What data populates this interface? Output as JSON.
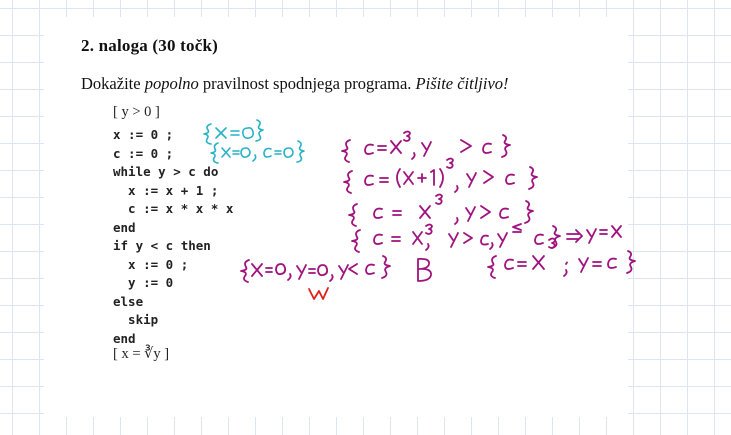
{
  "task": {
    "title": "2. naloga (30 točk)",
    "text_before": "Dokažite ",
    "text_emph1": "popolno",
    "text_mid": " pravilnost spodnjega programa. ",
    "text_emph2": "Pišite čitljivo!"
  },
  "program": {
    "precondition": "[ y > 0 ]",
    "lines": [
      "x := 0 ;",
      "c := 0 ;",
      "while y > c do",
      "  x := x + 1 ;",
      "  c := x * x * x",
      "end",
      "if y < c then",
      "  x := 0 ;",
      "  y := 0",
      "else",
      "  skip",
      "end"
    ],
    "postcondition": "[ x = ∛y ]"
  },
  "annotations": {
    "cyan_1": "{x = 0}",
    "cyan_2": "{x=0 , c=0}",
    "inv_1": "{ c=x³, y > c }",
    "inv_2": "{ c = (x+1)³, y > c }",
    "inv_3": "{ c = x³, y > c }",
    "inv_4": "{ c = x³, y > c, y ≤ c } ⇒ y=x",
    "if_branch": "{x=0, y=0, y<c}",
    "else_branch": "B",
    "post_branch": "{ c = x³ ; y = c }",
    "mark": "w"
  },
  "colors": {
    "cyan": "#27b2c6",
    "magenta": "#a0127e",
    "red": "#e0201b",
    "grid": "#dbe6f2"
  }
}
